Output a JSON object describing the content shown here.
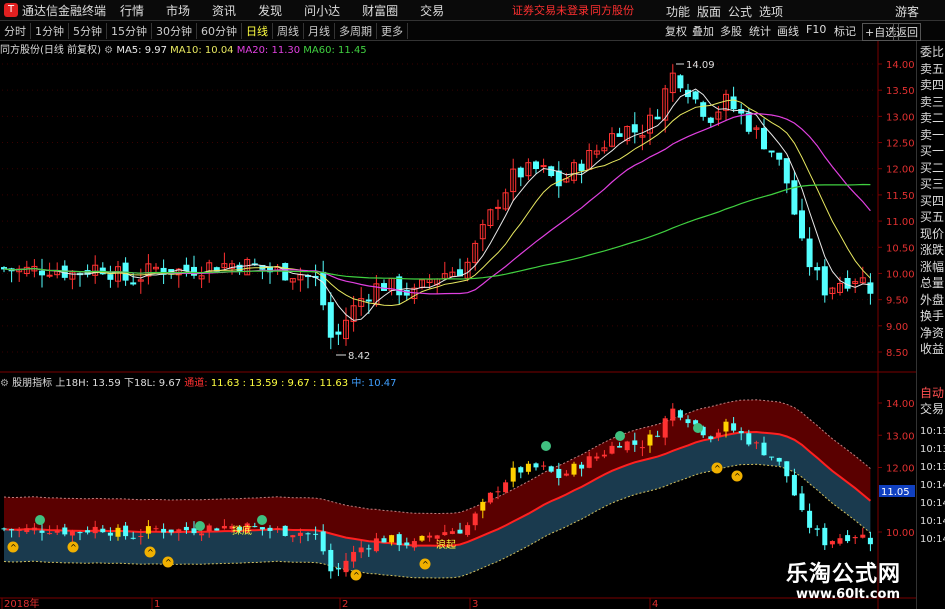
{
  "app": {
    "name": "通达信金融终端"
  },
  "menu": [
    "行情",
    "市场",
    "资讯",
    "发现",
    "问小达",
    "财富圈",
    "交易"
  ],
  "notice": {
    "status": "证券交易未登录",
    "stock": "同方股份"
  },
  "menu_right": [
    "功能",
    "版面",
    "公式",
    "选项",
    "游客"
  ],
  "toolbar": {
    "periods": [
      "分时",
      "1分钟",
      "5分钟",
      "15分钟",
      "30分钟",
      "60分钟",
      "日线",
      "周线",
      "月线",
      "多周期",
      "更多"
    ],
    "active": "日线",
    "right": [
      "复权",
      "叠加",
      "多股",
      "统计",
      "画线",
      "F10",
      "标记",
      "+自选",
      "返回"
    ]
  },
  "main_header": {
    "title": "同方股份(日线 前复权)",
    "ma5": "MA5: 9.97",
    "ma10": "MA10: 10.04",
    "ma20": "MA20: 11.30",
    "ma60": "MA60: 11.45",
    "c_ma5": "#e8e8e8",
    "c_ma10": "#e8e860",
    "c_ma20": "#e040e0",
    "c_ma60": "#40d040"
  },
  "main_axis": [
    "14.00",
    "13.50",
    "13.00",
    "12.50",
    "12.00",
    "11.50",
    "11.00",
    "10.50",
    "10.00",
    "9.50",
    "9.00",
    "8.50"
  ],
  "high_label": "14.09",
  "low_label": "8.42",
  "ind_header": {
    "name": "股朋指标",
    "h18": "上18H: 13.59",
    "l18": "下18L: 9.67",
    "ch_label": "通道:",
    "ch_vals": "11.63 : 13.59 : 9.67 : 11.63",
    "mid": "中: 10.47"
  },
  "ind_axis": [
    "14.00",
    "13.00",
    "12.00",
    "10.00"
  ],
  "ind_value_tag": "11.05",
  "x_labels": [
    "2018年",
    "1",
    "2",
    "3",
    "4"
  ],
  "side_labels": [
    "委比",
    "卖五",
    "卖四",
    "卖三",
    "卖二",
    "卖一",
    "买一",
    "买二",
    "买三",
    "买四",
    "买五",
    "现价",
    "涨跌",
    "涨幅",
    "总量",
    "外盘",
    "换手",
    "净资",
    "收益"
  ],
  "side_bottom": {
    "auto": "自动",
    "trade": "交易"
  },
  "side_times": [
    "10:13",
    "10:13",
    "10:13",
    "10:14",
    "10:14",
    "10:14",
    "10:14"
  ],
  "markers": {
    "bottom_text": "探底",
    "wave_text": "浪起"
  },
  "watermark": {
    "cn": "乐淘公式网",
    "url": "www.60lt.com"
  },
  "colors": {
    "up": "#ff3232",
    "down": "#54ffff",
    "bg": "#000000",
    "grid": "#7a0000"
  }
}
